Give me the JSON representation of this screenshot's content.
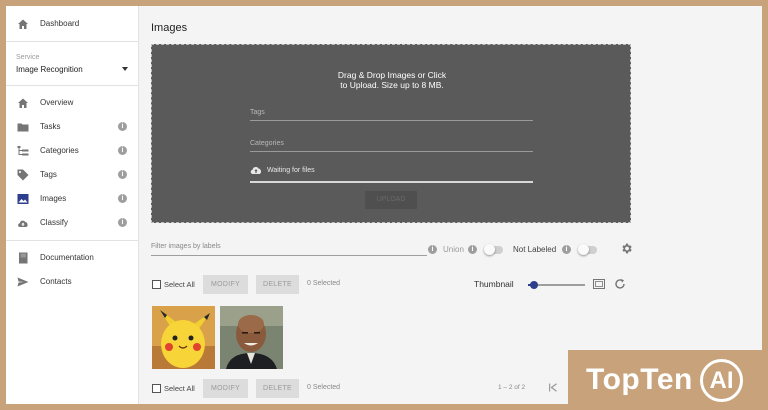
{
  "sidebar": {
    "dashboard": "Dashboard",
    "service_label": "Service",
    "service_value": "Image Recognition",
    "items": [
      {
        "label": "Overview",
        "icon": "home-icon"
      },
      {
        "label": "Tasks",
        "icon": "folder-icon"
      },
      {
        "label": "Categories",
        "icon": "hierarchy-icon"
      },
      {
        "label": "Tags",
        "icon": "tag-icon"
      },
      {
        "label": "Images",
        "icon": "image-icon"
      },
      {
        "label": "Classify",
        "icon": "cloud-upload-icon"
      }
    ],
    "documentation": "Documentation",
    "contacts": "Contacts"
  },
  "main": {
    "title": "Images",
    "dropzone": {
      "line1": "Drag & Drop Images or Click",
      "line2": "to Upload. Size up to 8 MB.",
      "tags_placeholder": "Tags",
      "categories_placeholder": "Categories",
      "status": "Waiting for files",
      "upload_button": "UPLOAD"
    },
    "filter": {
      "placeholder": "Filter images by labels",
      "union_label": "Union",
      "not_labeled_label": "Not Labeled"
    },
    "actions_top": {
      "select_all": "Select All",
      "modify": "MODIFY",
      "delete": "DELETE",
      "selected": "0 Selected",
      "thumbnail_label": "Thumbnail",
      "thumbnail_level": 0.1
    },
    "actions_bottom": {
      "select_all": "Select All",
      "modify": "MODIFY",
      "delete": "DELETE",
      "selected": "0 Selected",
      "pagination": "1 – 2 of 2"
    }
  },
  "watermark": {
    "brand": "TopTen",
    "brand_mark": "AI"
  },
  "colors": {
    "accent": "#2c3e8c",
    "dropzone": "#5a5a5a",
    "frame": "#c8a27a"
  }
}
